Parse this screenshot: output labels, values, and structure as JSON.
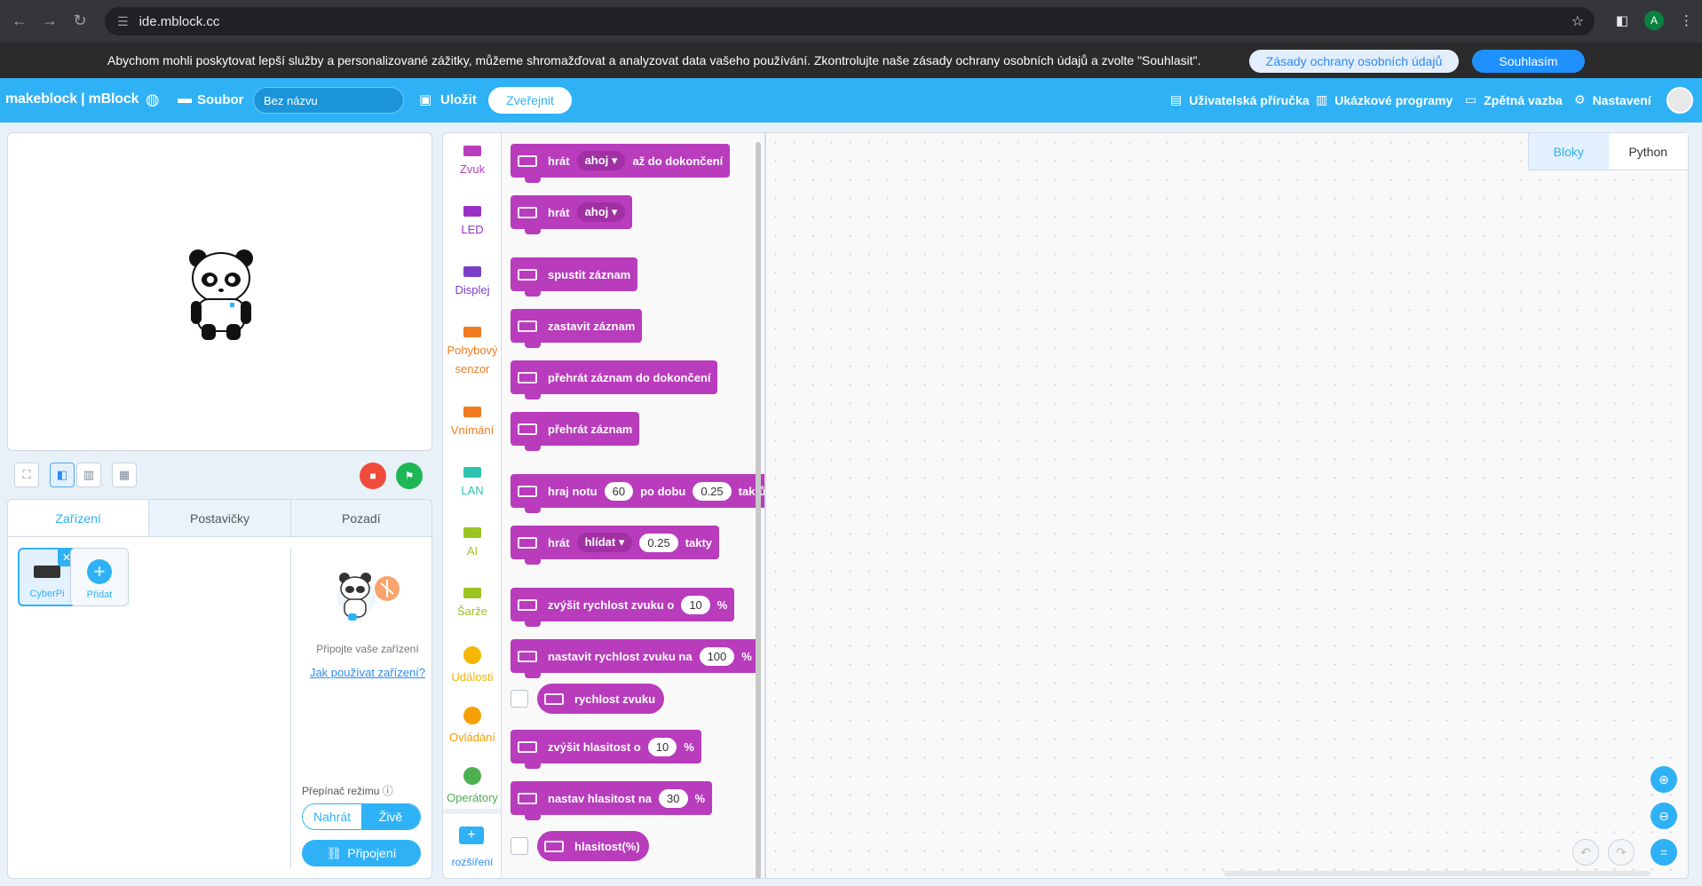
{
  "browser": {
    "url": "ide.mblock.cc",
    "profile_initial": "A"
  },
  "banner": {
    "text": "Abychom mohli poskytovat lepší služby a personalizované zážitky, můžeme shromažďovat a analyzovat data vašeho používání. Zkontrolujte naše zásady ochrany osobních údajů a zvolte \"Souhlasit\".",
    "policy_button": "Zásady ochrany osobních údajů",
    "agree_button": "Souhlasím"
  },
  "header": {
    "brand": "makeblock | mBlock",
    "file_label": "Soubor",
    "project_name": "Bez názvu",
    "save_label": "Uložit",
    "publish_label": "Zveřejnit",
    "user_guide": "Uživatelská příručka",
    "examples": "Ukázkové programy",
    "feedback": "Zpětná vazba",
    "settings": "Nastavení"
  },
  "devices_panel": {
    "tabs": [
      "Zařízení",
      "Postavičky",
      "Pozadí"
    ],
    "active_tab": "Zařízení",
    "device_name": "CyberPi",
    "add_label": "Přidat",
    "connect_hint": "Připojte vaše zařízení",
    "how_link": "Jak používat zařízení?",
    "mode_label": "Přepínač režimu",
    "mode_upload": "Nahrát",
    "mode_live": "Živě",
    "connect_button": "Připojení"
  },
  "categories": [
    {
      "label": "Zvuk",
      "color": "#b83cbc"
    },
    {
      "label": "LED",
      "color": "#9b30c8"
    },
    {
      "label": "Displej",
      "color": "#7a3fc8"
    },
    {
      "label": "Pohybový senzor",
      "color": "#f27b21"
    },
    {
      "label": "Vnímání",
      "color": "#f27b21"
    },
    {
      "label": "LAN",
      "color": "#2fc3b0"
    },
    {
      "label": "AI",
      "color": "#9ac420"
    },
    {
      "label": "Šarže",
      "color": "#9ac420"
    },
    {
      "label": "Události",
      "color": "#f5b700"
    },
    {
      "label": "Ovládání",
      "color": "#f5a000"
    },
    {
      "label": "Operátory",
      "color": "#4cb050"
    }
  ],
  "extension_label": "rozšíření",
  "blocks": {
    "b1": {
      "pre": "hrát",
      "dropdown": "ahoj",
      "post": "až do dokončení"
    },
    "b2": {
      "pre": "hrát",
      "dropdown": "ahoj"
    },
    "b3": {
      "text": "spustit záznam"
    },
    "b4": {
      "text": "zastavit záznam"
    },
    "b5": {
      "text": "přehrát záznam do dokončení"
    },
    "b6": {
      "text": "přehrát záznam"
    },
    "b7": {
      "pre": "hraj notu",
      "v1": "60",
      "mid": "po dobu",
      "v2": "0.25",
      "post": "taktů"
    },
    "b8": {
      "pre": "hrát",
      "dropdown": "hlídat",
      "v": "0.25",
      "post": "takty"
    },
    "b9": {
      "pre": "zvýšit rychlost zvuku o",
      "v": "10",
      "post": "%"
    },
    "b10": {
      "pre": "nastavit rychlost zvuku na",
      "v": "100",
      "post": "%"
    },
    "b11": {
      "text": "rychlost zvuku"
    },
    "b12": {
      "pre": "zvýšit hlasitost o",
      "v": "10",
      "post": "%"
    },
    "b13": {
      "pre": "nastav hlasitost na",
      "v": "30",
      "post": "%"
    },
    "b14": {
      "text": "hlasitost(%)"
    }
  },
  "code_tabs": {
    "blocks": "Bloky",
    "python": "Python"
  },
  "colors": {
    "accent": "#2fb1f6",
    "sound_block": "#b83cbc"
  }
}
